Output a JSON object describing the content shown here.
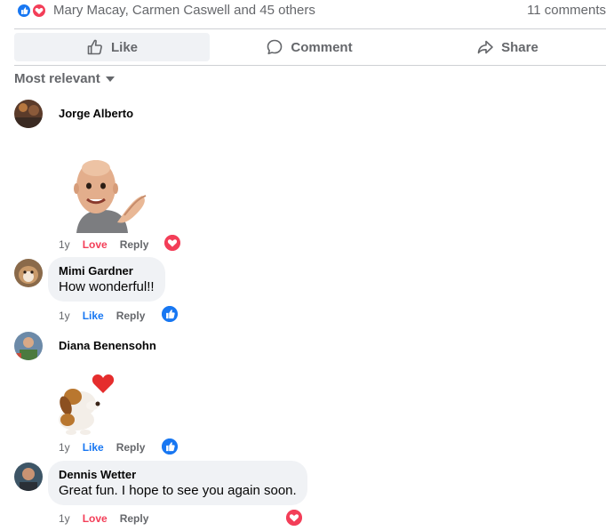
{
  "summary": {
    "reactors_text": "Mary Macay, Carmen Caswell and 45 others",
    "comments_count": "11 comments"
  },
  "actions": {
    "like": "Like",
    "comment": "Comment",
    "share": "Share"
  },
  "sort": {
    "label": "Most relevant"
  },
  "comments": [
    {
      "author": "Jorge Alberto",
      "text": "",
      "attachment": "sticker-bald-man-clapping",
      "time": "1y",
      "reaction_label": "Love",
      "reply_label": "Reply",
      "badge": "love-reaction-icon"
    },
    {
      "author": "Mimi Gardner",
      "text": "How wonderful!!",
      "time": "1y",
      "reaction_label": "Like",
      "reply_label": "Reply",
      "badge": "like-reaction-icon"
    },
    {
      "author": "Diana Benensohn",
      "text": "",
      "attachment": "sticker-puppy-heart",
      "time": "1y",
      "reaction_label": "Like",
      "reply_label": "Reply",
      "badge": "like-reaction-icon"
    },
    {
      "author": "Dennis Wetter",
      "text": "Great fun. I hope to see you again soon.",
      "time": "1y",
      "reaction_label": "Love",
      "reply_label": "Reply",
      "badge": "love-reaction-icon"
    }
  ],
  "colors": {
    "like_blue": "#1877f2",
    "love_red": "#f33e58",
    "secondary_text": "#65676b",
    "bubble_bg": "#f0f2f5"
  }
}
